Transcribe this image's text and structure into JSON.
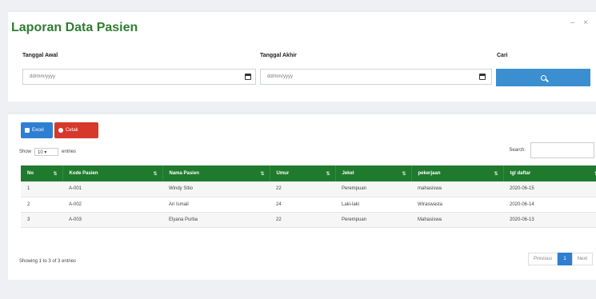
{
  "title": "Laporan Data Pasien",
  "card_tools": "– ×",
  "filter": {
    "start_label": "Tanggal Awal",
    "start_placeholder": "dd/mm/yyyy",
    "end_label": "Tanggal Akhir",
    "end_placeholder": "dd/mm/yyyy",
    "search_label": "Cari"
  },
  "buttons": {
    "excel": "Excel",
    "print": "Cetak"
  },
  "table_controls": {
    "show_label": "Show",
    "show_value": "10",
    "entries_label": "entries",
    "search_label": "Search:"
  },
  "table": {
    "columns": [
      "No",
      "Kode Pasien",
      "Nama Pasien",
      "Umur",
      "Jekel",
      "pekerjaan",
      "tgl daftar"
    ],
    "rows": [
      [
        "1",
        "A-001",
        "Windy Sitio",
        "22",
        "Perempuan",
        "mahasiswa",
        "2020-06-15"
      ],
      [
        "2",
        "A-002",
        "Ari Ismail",
        "24",
        "Laki-laki",
        "Wiraswasta",
        "2020-06-14"
      ],
      [
        "3",
        "A-003",
        "Elyana Purba",
        "22",
        "Perempuan",
        "Mahasiswa",
        "2020-06-13"
      ]
    ]
  },
  "footer": {
    "info": "Showing 1 to 3 of 3 entries",
    "previous": "Previous",
    "page": "1",
    "next": "Next"
  },
  "colors": {
    "header_green": "#1f7a2e",
    "title_green": "#2e7d32",
    "accent_blue": "#3b8fd0",
    "print_red": "#d6382b"
  }
}
